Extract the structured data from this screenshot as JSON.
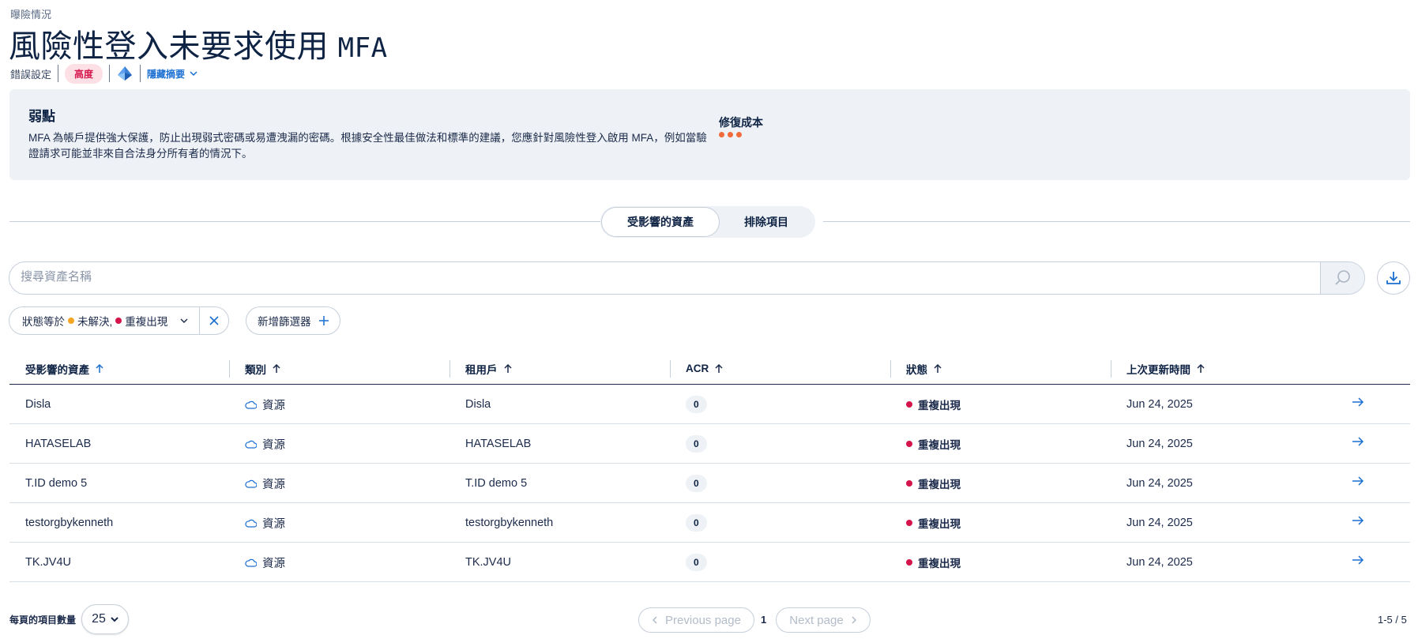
{
  "breadcrumb": "曝險情況",
  "title": {
    "text": "風險性登入未要求使用",
    "suffix": "MFA"
  },
  "meta": {
    "category": "錯誤設定",
    "severity": "高度",
    "provider_icon": "azure-icon",
    "toggle_label": "隱藏摘要"
  },
  "summary": {
    "weakness_title": "弱點",
    "weakness_desc": "MFA 為帳戶提供強大保護，防止出現弱式密碼或易遭洩漏的密碼。根據安全性最佳做法和標準的建議，您應針對風險性登入啟用 MFA，例如當驗證請求可能並非來自合法身分所有者的情況下。",
    "cost_title": "修復成本",
    "cost_level": 3
  },
  "tabs": [
    {
      "label": "受影響的資產",
      "active": true
    },
    {
      "label": "排除項目",
      "active": false
    }
  ],
  "search": {
    "placeholder": "搜尋資產名稱"
  },
  "filter": {
    "prefix": "狀態等於",
    "value1": "未解決,",
    "value2": "重複出現"
  },
  "add_filter": "新增篩選器",
  "table": {
    "columns": [
      "受影響的資產",
      "類別",
      "租用戶",
      "ACR",
      "狀態",
      "上次更新時間"
    ],
    "rows": [
      {
        "asset": "Disla",
        "category": "資源",
        "tenant": "Disla",
        "acr": "0",
        "status": "重複出現",
        "updated": "Jun 24, 2025"
      },
      {
        "asset": "HATASELAB",
        "category": "資源",
        "tenant": "HATASELAB",
        "acr": "0",
        "status": "重複出現",
        "updated": "Jun 24, 2025"
      },
      {
        "asset": "T.ID demo 5",
        "category": "資源",
        "tenant": "T.ID demo 5",
        "acr": "0",
        "status": "重複出現",
        "updated": "Jun 24, 2025"
      },
      {
        "asset": "testorgbykenneth",
        "category": "資源",
        "tenant": "testorgbykenneth",
        "acr": "0",
        "status": "重複出現",
        "updated": "Jun 24, 2025"
      },
      {
        "asset": "TK.JV4U",
        "category": "資源",
        "tenant": "TK.JV4U",
        "acr": "0",
        "status": "重複出現",
        "updated": "Jun 24, 2025"
      }
    ]
  },
  "pagination": {
    "per_page_label": "每頁的項目數量",
    "per_page": "25",
    "prev": "Previous page",
    "next": "Next page",
    "current": "1",
    "range": "1-5 / 5"
  },
  "colors": {
    "accent": "#1a6fd1",
    "severity_high": "#d4144a",
    "status_recurring": "#d4144a",
    "status_open": "#f5a524",
    "cost": "#f06a3a"
  }
}
